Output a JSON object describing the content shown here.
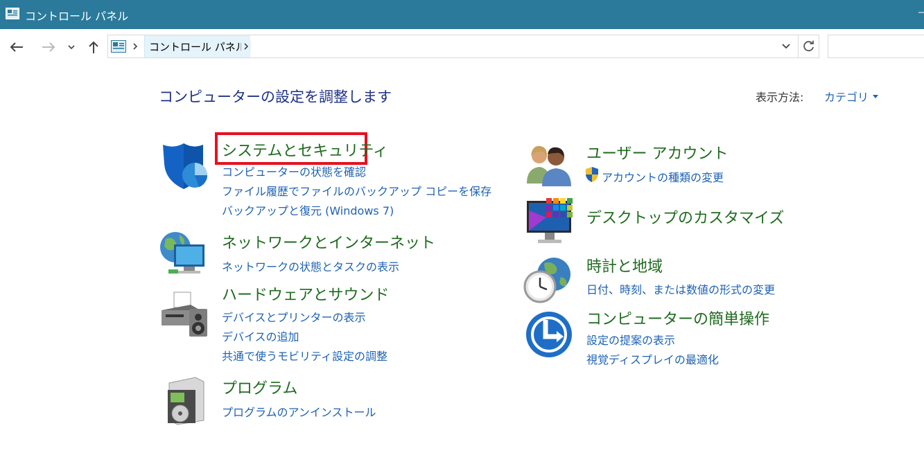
{
  "window": {
    "title": "コントロール パネル"
  },
  "address": {
    "breadcrumb": "コントロール パネル",
    "search_placeholder": ""
  },
  "heading": "コンピューターの設定を調整します",
  "view_by": {
    "label": "表示方法:",
    "value": "カテゴリ"
  },
  "categories": [
    {
      "title": "システムとセキュリティ",
      "links": [
        "コンピューターの状態を確認",
        "ファイル履歴でファイルのバックアップ コピーを保存",
        "バックアップと復元 (Windows 7)"
      ],
      "icon": "shield-icon"
    },
    {
      "title": "ネットワークとインターネット",
      "links": [
        "ネットワークの状態とタスクの表示"
      ],
      "icon": "network-icon"
    },
    {
      "title": "ハードウェアとサウンド",
      "links": [
        "デバイスとプリンターの表示",
        "デバイスの追加",
        "共通で使うモビリティ設定の調整"
      ],
      "icon": "printer-icon"
    },
    {
      "title": "プログラム",
      "links": [
        "プログラムのアンインストール"
      ],
      "icon": "programs-icon"
    },
    {
      "title": "ユーザー アカウント",
      "links": [
        "アカウントの種類の変更"
      ],
      "icon": "users-icon"
    },
    {
      "title": "デスクトップのカスタマイズ",
      "links": [],
      "icon": "desktop-icon"
    },
    {
      "title": "時計と地域",
      "links": [
        "日付、時刻、または数値の形式の変更"
      ],
      "icon": "clock-globe-icon"
    },
    {
      "title": "コンピューターの簡単操作",
      "links": [
        "設定の提案の表示",
        "視覚ディスプレイの最適化"
      ],
      "icon": "ease-of-access-icon"
    }
  ]
}
